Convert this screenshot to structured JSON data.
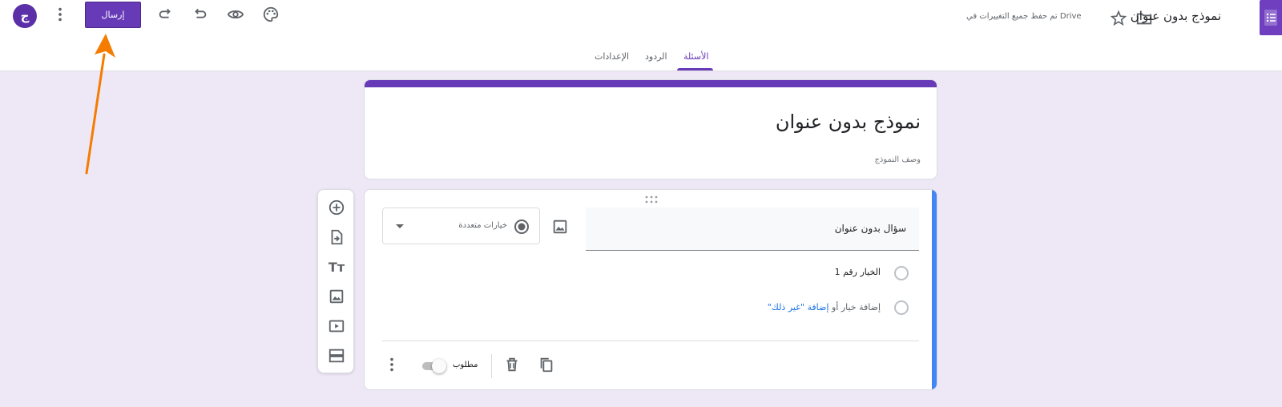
{
  "topbar": {
    "avatar_letter": "ج",
    "send_label": "إرسال",
    "saved_note": "تم حفظ جميع التغييرات في Drive",
    "doc_title": "نموذج بدون عنوان"
  },
  "tabs": [
    {
      "label": "الأسئلة",
      "active": true
    },
    {
      "label": "الردود",
      "active": false
    },
    {
      "label": "الإعدادات",
      "active": false
    }
  ],
  "form": {
    "title": "نموذج بدون عنوان",
    "description_placeholder": "وصف النموذج"
  },
  "question": {
    "title": "سؤال بدون عنوان",
    "type_label": "خيارات متعددة",
    "options": [
      "الخيار رقم 1"
    ],
    "add_option": "إضافة خيار",
    "or_text": "أو",
    "add_other": "إضافة \"غير ذلك\"",
    "required_label": "مطلوب",
    "required_on": false
  },
  "colors": {
    "accent": "#673ab7",
    "background": "#ede7f6",
    "active_question": "#4285f4",
    "annotation_arrow": "#f57c00"
  },
  "icons": {
    "topbar": [
      "avatar",
      "more-vert-icon",
      "redo-icon",
      "undo-icon",
      "preview-eye-icon",
      "palette-icon",
      "folder-icon",
      "star-icon",
      "forms-logo-icon"
    ],
    "side_toolbar": [
      "add-question-icon",
      "import-questions-icon",
      "add-title-icon",
      "add-image-icon",
      "add-video-icon",
      "add-section-icon"
    ],
    "question_footer": [
      "more-vert-icon",
      "delete-icon",
      "duplicate-icon"
    ]
  }
}
